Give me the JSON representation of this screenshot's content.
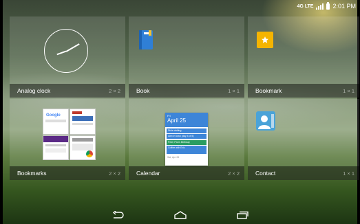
{
  "status_bar": {
    "network": "4G LTE",
    "time": "2:01 PM"
  },
  "widgets": [
    {
      "name": "Analog clock",
      "size": "2 × 2",
      "icon": "analog-clock-icon"
    },
    {
      "name": "Book",
      "size": "1 × 1",
      "icon": "book-icon"
    },
    {
      "name": "Bookmark",
      "size": "1 × 1",
      "icon": "bookmark-star-icon"
    },
    {
      "name": "Bookmarks",
      "size": "2 × 2",
      "icon": "bookmarks-thumbnails"
    },
    {
      "name": "Calendar",
      "size": "2 × 2",
      "icon": "calendar-preview"
    },
    {
      "name": "Contact",
      "size": "1 × 1",
      "icon": "contact-icon"
    }
  ],
  "calendar_preview": {
    "day": "Fri",
    "date": "April 25",
    "events": [
      {
        "text": "Dixie visiting",
        "color": "#3d85d8"
      },
      {
        "text": "Alex in town (day 4 of 5)",
        "color": "#3d85d8"
      },
      {
        "text": "Peter Pan's Birthday",
        "color": "#2a9d62"
      },
      {
        "text": "Coffee with Eric",
        "color": "#3d85d8"
      }
    ],
    "footer": "Sat, Apr 26"
  },
  "colors": {
    "accent_blue": "#3d85d8",
    "bookmark_yellow": "#f5b400",
    "book_blue": "#2f7fd6"
  }
}
